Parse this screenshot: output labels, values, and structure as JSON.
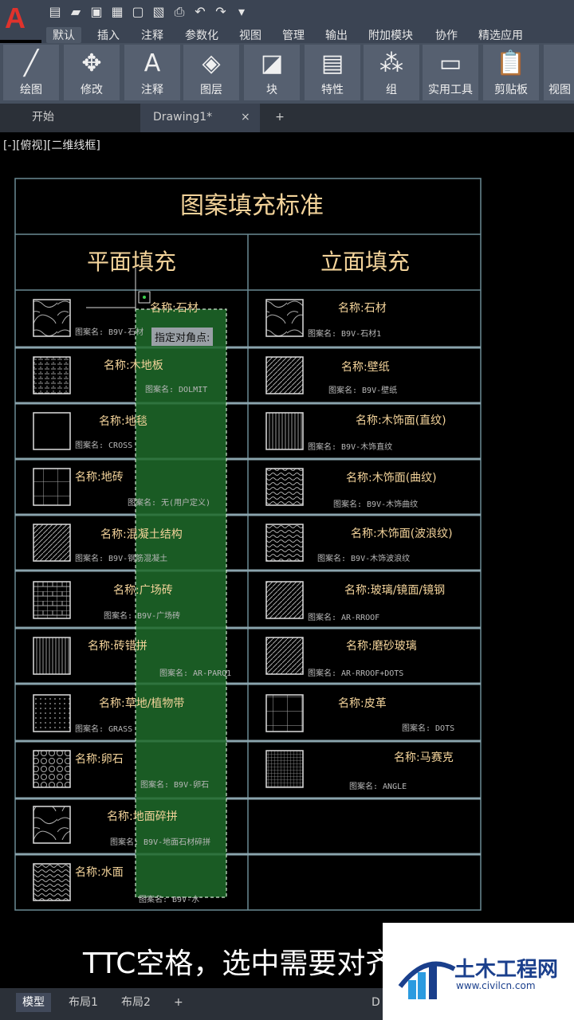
{
  "app": {
    "logo_letter": "A"
  },
  "ribbon": {
    "tabs": [
      "默认",
      "插入",
      "注释",
      "参数化",
      "视图",
      "管理",
      "输出",
      "附加模块",
      "协作",
      "精选应用"
    ],
    "tools": [
      "绘图",
      "修改",
      "注释",
      "图层",
      "块",
      "特性",
      "组",
      "实用工具",
      "剪贴板",
      "视图"
    ]
  },
  "doc_tabs": {
    "start": "开始",
    "drawing": "Drawing1*",
    "close": "×",
    "add": "+"
  },
  "viewport": {
    "label": "[-][俯视][二维线框]"
  },
  "table": {
    "title": "图案填充标准",
    "left_header": "平面填充",
    "right_header": "立面填充",
    "left": [
      {
        "name": "名称:石材",
        "pattern": "图案名: B9V-石材"
      },
      {
        "name": "名称:木地板",
        "pattern": "图案名: DOLMIT"
      },
      {
        "name": "名称:地毯",
        "pattern": "图案名: CROSS"
      },
      {
        "name": "名称:地砖",
        "pattern": "图案名: 无(用户定义)"
      },
      {
        "name": "名称:混凝土结构",
        "pattern": "图案名: B9V-钢筋混凝土"
      },
      {
        "name": "名称:广场砖",
        "pattern": "图案名: B9V-广场砖"
      },
      {
        "name": "名称:砖错拼",
        "pattern": "图案名: AR-PARQ1"
      },
      {
        "name": "名称:草地/植物带",
        "pattern": "图案名: GRASS"
      },
      {
        "name": "名称:卵石",
        "pattern": "图案名: B9V-卵石"
      },
      {
        "name": "名称:地面碎拼",
        "pattern": "图案名: B9V-地面石材碎拼"
      },
      {
        "name": "名称:水面",
        "pattern": "图案名: B9V-水"
      }
    ],
    "right": [
      {
        "name": "名称:石材",
        "pattern": "图案名: B9V-石材1"
      },
      {
        "name": "名称:壁纸",
        "pattern": "图案名: B9V-壁纸"
      },
      {
        "name": "名称:木饰面(直纹)",
        "pattern": "图案名: B9V-木饰直纹"
      },
      {
        "name": "名称:木饰面(曲纹)",
        "pattern": "图案名: B9V-木饰曲纹"
      },
      {
        "name": "名称:木饰面(波浪纹)",
        "pattern": "图案名: B9V-木饰波浪纹"
      },
      {
        "name": "名称:玻璃/镜面/镜钢",
        "pattern": "图案名: AR-RROOF"
      },
      {
        "name": "名称:磨砂玻璃",
        "pattern": "图案名: AR-RROOF+DOTS"
      },
      {
        "name": "名称:皮革",
        "pattern": "图案名: DOTS"
      },
      {
        "name": "名称:马赛克",
        "pattern": "图案名: ANGLE"
      }
    ]
  },
  "tooltip": "指定对角点:",
  "bottom_tabs": [
    "模型",
    "布局1",
    "布局2",
    "+"
  ],
  "bottom_right": "D",
  "subtitle": "TTC空格，选中需要对齐",
  "watermark": {
    "title": "土木工程网",
    "url": "www.civilcn.com"
  },
  "colors": {
    "accent_red": "#e0322c",
    "table_line": "#6b8a94",
    "label": "#f3d39a",
    "selection_green": "#1f6b2a"
  }
}
